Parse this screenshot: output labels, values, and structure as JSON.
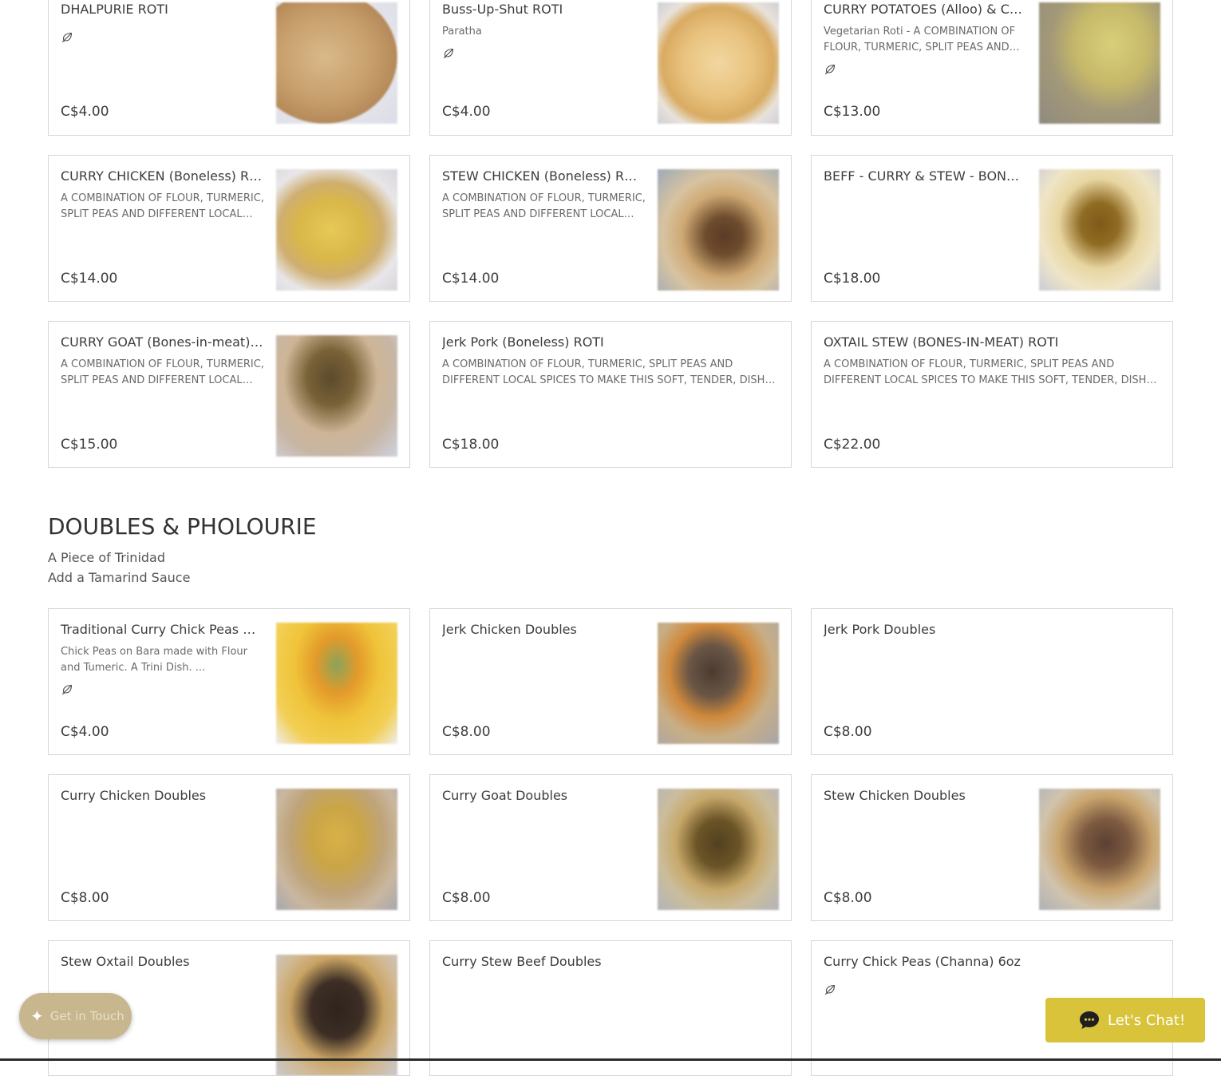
{
  "roti": {
    "items": [
      {
        "name": "DHALPURIE ROTI",
        "desc": "",
        "price": "C$4.00",
        "veg": true,
        "img": "dhalpurie"
      },
      {
        "name": "Buss-Up-Shut ROTI",
        "desc": "Paratha",
        "price": "C$4.00",
        "veg": true,
        "img": "bussupshut"
      },
      {
        "name": "CURRY POTATOES (Alloo) & CHICKPEAS ROTI",
        "desc": "Vegetarian Roti - A COMBINATION OF FLOUR, TURMERIC, SPLIT PEAS AND DIFFERENT LOCAL SPICES",
        "price": "C$13.00",
        "veg": true,
        "img": "alloo"
      },
      {
        "name": "CURRY CHICKEN (Boneless) ROTI",
        "desc": "A COMBINATION OF FLOUR, TURMERIC, SPLIT PEAS AND DIFFERENT LOCAL SPICES TO MAKE THIS SOFT, TENDER, DISH CALL DHALPURIE",
        "price": "C$14.00",
        "veg": false,
        "img": "currychicken"
      },
      {
        "name": "STEW CHICKEN (Boneless) ROTI",
        "desc": "A COMBINATION OF FLOUR, TURMERIC, SPLIT PEAS AND DIFFERENT LOCAL SPICES TO MAKE THIS SOFT, TENDER, DISH CALL DHALPURIE",
        "price": "C$14.00",
        "veg": false,
        "img": "stewchicken"
      },
      {
        "name": "BEFF - CURRY & STEW - BONELESS",
        "desc": "",
        "price": "C$18.00",
        "veg": false,
        "img": "beef"
      },
      {
        "name": "CURRY GOAT (Bones-in-meat) ROTI",
        "desc": "A COMBINATION OF FLOUR, TURMERIC, SPLIT PEAS AND DIFFERENT LOCAL SPICES TO MAKE THIS SOFT, TENDER, DISH CALL DHALPURIE",
        "price": "C$15.00",
        "veg": false,
        "img": "goat"
      },
      {
        "name": "Jerk Pork (Boneless) ROTI",
        "desc": "A COMBINATION OF FLOUR, TURMERIC, SPLIT PEAS AND DIFFERENT LOCAL SPICES TO MAKE THIS SOFT, TENDER, DISH CALL DHALPURIE",
        "price": "C$18.00",
        "veg": false,
        "img": null
      },
      {
        "name": "OXTAIL STEW (BONES-IN-MEAT) ROTI",
        "desc": "A COMBINATION OF FLOUR, TURMERIC, SPLIT PEAS AND DIFFERENT LOCAL SPICES TO MAKE THIS SOFT, TENDER, DISH CALL DHALPURIE",
        "price": "C$22.00",
        "veg": false,
        "img": null
      }
    ]
  },
  "doubles": {
    "title": "DOUBLES & PHOLOURIE",
    "subtitle_1": "A Piece of Trinidad",
    "subtitle_2": "Add a Tamarind Sauce",
    "items": [
      {
        "name": "Traditional Curry Chick Peas Doubles",
        "desc": "Chick Peas on Bara made with Flour and Tumeric.  A Trini Dish.  ...",
        "price": "C$4.00",
        "veg": true,
        "img": "chickpeas"
      },
      {
        "name": "Jerk Chicken Doubles",
        "desc": "",
        "price": "C$8.00",
        "veg": false,
        "img": "jerkchicken"
      },
      {
        "name": "Jerk Pork Doubles",
        "desc": "",
        "price": "C$8.00",
        "veg": false,
        "img": null
      },
      {
        "name": "Curry Chicken Doubles",
        "desc": "",
        "price": "C$8.00",
        "veg": false,
        "img": "currychickendoubles"
      },
      {
        "name": "Curry Goat Doubles",
        "desc": "",
        "price": "C$8.00",
        "veg": false,
        "img": "goatdoubles"
      },
      {
        "name": "Stew Chicken Doubles",
        "desc": "",
        "price": "C$8.00",
        "veg": false,
        "img": "stewchickendoubles"
      },
      {
        "name": "Stew Oxtail Doubles",
        "desc": "",
        "price": "",
        "veg": false,
        "img": "oxtaildoubles"
      },
      {
        "name": "Curry Stew Beef Doubles",
        "desc": "",
        "price": "",
        "veg": false,
        "img": null
      },
      {
        "name": "Curry Chick Peas (Channa) 6oz",
        "desc": "",
        "price": "",
        "veg": true,
        "img": null
      }
    ]
  },
  "widgets": {
    "get_in_touch": "Get in Touch",
    "chat": "Let's Chat!"
  },
  "icons": {
    "leaf": "leaf-icon",
    "sparkle": "sparkle-icon",
    "chat": "chat-bubble-icon"
  },
  "colors": {
    "accent": "#d9c33a",
    "button": "#c8b78e",
    "border": "#d6d6d6"
  }
}
